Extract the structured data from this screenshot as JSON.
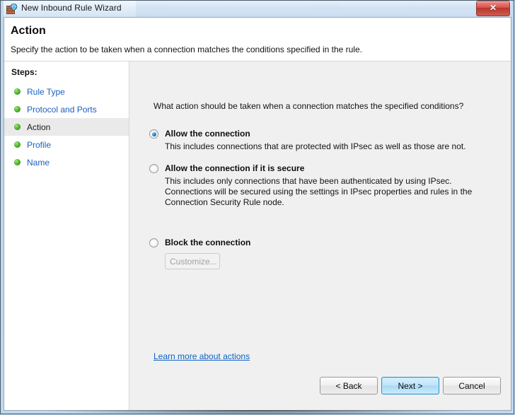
{
  "window": {
    "title": "New Inbound Rule Wizard",
    "icon": "firewall-rule-icon",
    "close_label": "✕"
  },
  "header": {
    "title": "Action",
    "subtitle": "Specify the action to be taken when a connection matches the conditions specified in the rule."
  },
  "sidebar": {
    "heading": "Steps:",
    "items": [
      {
        "label": "Rule Type",
        "current": false
      },
      {
        "label": "Protocol and Ports",
        "current": false
      },
      {
        "label": "Action",
        "current": true
      },
      {
        "label": "Profile",
        "current": false
      },
      {
        "label": "Name",
        "current": false
      }
    ]
  },
  "content": {
    "question": "What action should be taken when a connection matches the specified conditions?",
    "options": [
      {
        "title": "Allow the connection",
        "description": "This includes connections that are protected with IPsec as well as those are not.",
        "selected": true
      },
      {
        "title": "Allow the connection if it is secure",
        "description": "This includes only connections that have been authenticated by using IPsec.  Connections will be secured using the settings in IPsec properties and rules in the Connection Security Rule node.",
        "selected": false
      },
      {
        "title": "Block the connection",
        "description": "",
        "selected": false
      }
    ],
    "customize_label": "Customize...",
    "learn_more_label": "Learn more about actions"
  },
  "buttons": {
    "back": "< Back",
    "next": "Next >",
    "cancel": "Cancel"
  },
  "colors": {
    "link": "#0b62c8",
    "step_link": "#1b5fc1",
    "radio_dot": "#1a7fc1",
    "default_button_border": "#2f93d1",
    "close_button": "#b9352d"
  }
}
